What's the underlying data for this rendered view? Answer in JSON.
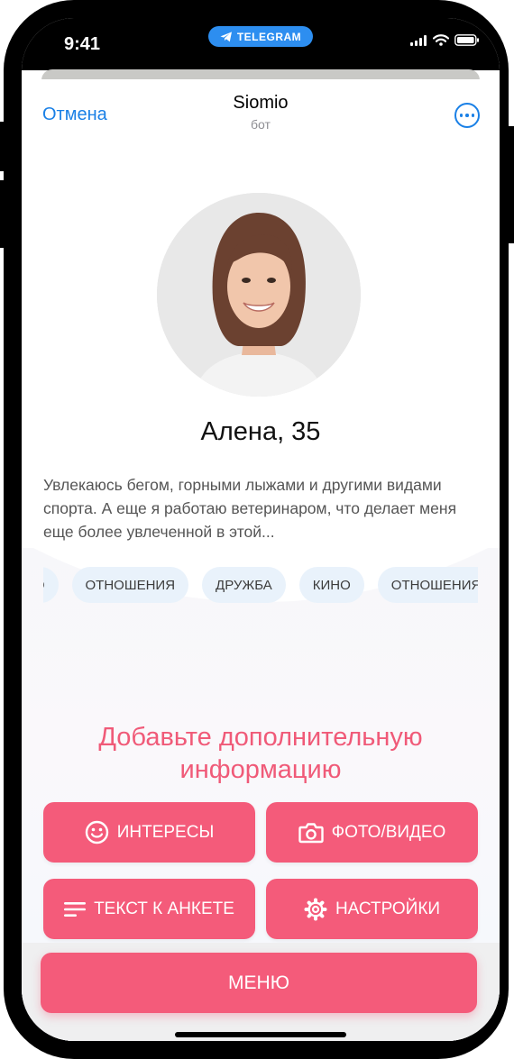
{
  "status_bar": {
    "time": "9:41",
    "app_pill": "TELEGRAM"
  },
  "header": {
    "cancel_label": "Отмена",
    "title": "Siomio",
    "subtitle": "бот"
  },
  "profile": {
    "name": "Алена, 35",
    "bio": "Увлекаюсь бегом, горными лыжами и другими видами спорта. А еще я работаю ветеринаром, что делает меня еще более увлеченной в этой...",
    "tags": [
      "НО",
      "ОТНОШЕНИЯ",
      "ДРУЖБА",
      "КИНО",
      "ОТНОШЕНИЯ"
    ]
  },
  "actions": {
    "headline": "Добавьте дополнительную информацию",
    "interests_label": "ИНТЕРЕСЫ",
    "photo_video_label": "ФОТО/ВИДЕО",
    "profile_text_label": "ТЕКСТ К АНКЕТЕ",
    "settings_label": "НАСТРОЙКИ"
  },
  "menu_label": "МЕНЮ",
  "colors": {
    "accent": "#f45b7a",
    "headline": "#f05a78",
    "link": "#1a80e6",
    "telegram": "#2d8ef0",
    "tag_bg": "#e9f2fb"
  }
}
